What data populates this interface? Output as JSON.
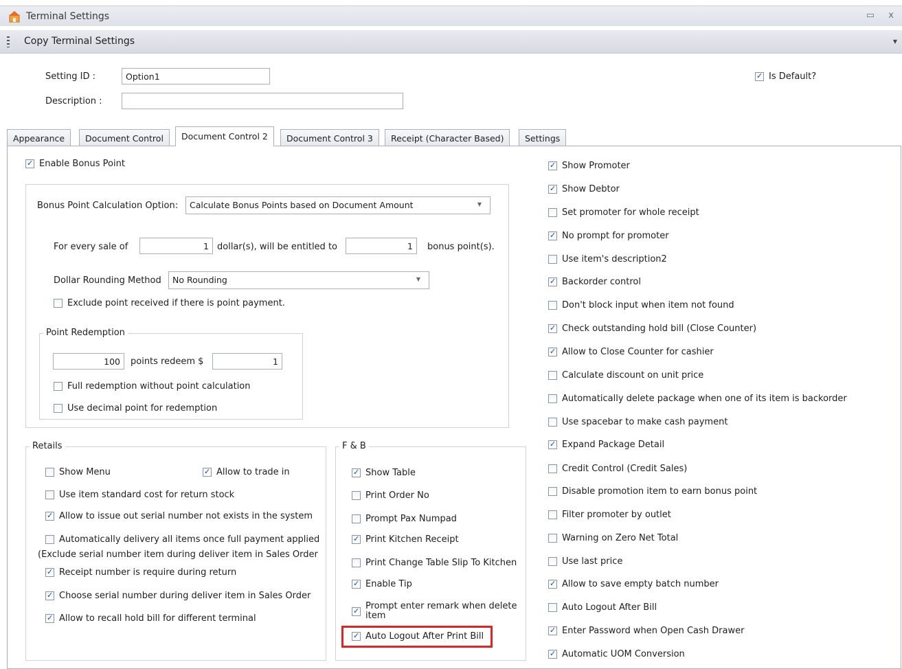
{
  "window": {
    "title": "Terminal Settings",
    "min_btn": "▭",
    "close_btn": "x"
  },
  "toolbar": {
    "copy_label": "Copy Terminal Settings"
  },
  "header": {
    "setting_id_label": "Setting ID :",
    "setting_id_value": "Option1",
    "description_label": "Description :",
    "description_value": "",
    "is_default_label": "Is Default?"
  },
  "tabs": [
    "Appearance",
    "Document Control",
    "Document Control 2",
    "Document Control 3",
    "Receipt (Character Based)",
    "Settings"
  ],
  "active_tab": "Document Control 2",
  "bonus": {
    "enable_label": "Enable Bonus Point",
    "calc_option_label": "Bonus Point Calculation Option:",
    "calc_option_value": "Calculate Bonus Points based on Document Amount",
    "sale_prefix": "For every sale of",
    "sale_amount": "1",
    "sale_middle": "dollar(s), will be entitled to",
    "points_amount": "1",
    "sale_suffix": "bonus point(s).",
    "rounding_label": "Dollar Rounding Method",
    "rounding_value": "No Rounding",
    "exclude_label": "Exclude point received if there is point payment.",
    "redemption_title": "Point Redemption",
    "redeem_points": "100",
    "redeem_middle": "points redeem $",
    "redeem_dollar": "1",
    "full_redemption_label": "Full redemption without point calculation",
    "decimal_label": "Use decimal point for redemption"
  },
  "retails": {
    "title": "Retails",
    "show_menu": "Show Menu",
    "allow_trade_in": "Allow to trade in",
    "std_cost": "Use item standard cost for return stock",
    "serial_not_exist": "Allow to issue out serial number not exists in the system",
    "auto_delivery": "Automatically delivery all items once full payment applied",
    "auto_delivery_note": "(Exclude serial number item during deliver item in Sales Order",
    "receipt_required": "Receipt number is require during return",
    "choose_serial": "Choose serial number during deliver item in Sales Order",
    "recall_hold": "Allow to recall hold bill for different terminal"
  },
  "fnb": {
    "title": "F & B",
    "show_table": "Show Table",
    "print_order_no": "Print Order No",
    "prompt_pax": "Prompt Pax Numpad",
    "print_kitchen": "Print Kitchen Receipt",
    "print_change_table": "Print Change Table Slip To Kitchen",
    "enable_tip": "Enable Tip",
    "prompt_remark_1": "Prompt enter remark when delete",
    "prompt_remark_2": "item",
    "auto_logout_print": "Auto Logout After Print Bill"
  },
  "right_options": [
    "Show Promoter",
    "Show Debtor",
    "Set promoter for whole receipt",
    "No prompt for promoter",
    "Use item's description2",
    "Backorder control",
    "Don't block input when item not found",
    "Check outstanding hold bill (Close Counter)",
    "Allow to Close Counter for cashier",
    "Calculate discount on unit price",
    "Automatically delete package when one of its item is backorder",
    "Use spacebar to make cash payment",
    "Expand Package Detail",
    "Credit Control (Credit Sales)",
    "Disable promotion item to earn bonus point",
    "Filter promoter by outlet",
    "Warning on Zero Net Total",
    "Use last price",
    "Allow to save empty batch number",
    "Auto Logout After Bill",
    "Enter Password when Open Cash Drawer",
    "Automatic UOM Conversion"
  ],
  "colors": {
    "highlight": "#e02424",
    "check": "#1f4e8c"
  }
}
